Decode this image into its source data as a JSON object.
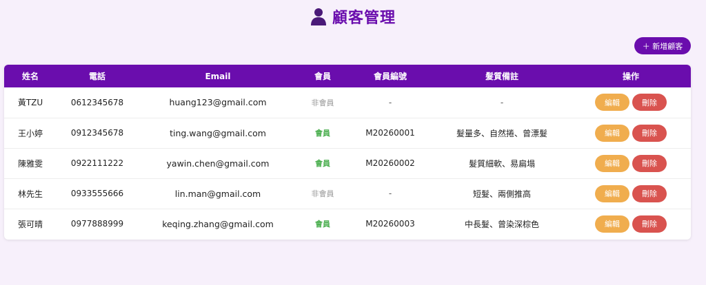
{
  "header": {
    "title": "顧客管理",
    "icon": "user-icon"
  },
  "toolbar": {
    "add_label": "＋ 新增顧客"
  },
  "table": {
    "columns": [
      "姓名",
      "電話",
      "Email",
      "會員",
      "會員編號",
      "髮質備註",
      "操作"
    ],
    "rows": [
      {
        "name": "黃TZU",
        "phone": "0612345678",
        "email": "huang123@gmail.com",
        "member": "非會員",
        "is_member": false,
        "member_id": "-",
        "note": "-",
        "edit": "編輯",
        "delete": "刪除"
      },
      {
        "name": "王小婷",
        "phone": "0912345678",
        "email": "ting.wang@gmail.com",
        "member": "會員",
        "is_member": true,
        "member_id": "M20260001",
        "note": "髮量多、自然捲、曾漂髮",
        "edit": "編輯",
        "delete": "刪除"
      },
      {
        "name": "陳雅雯",
        "phone": "0922111222",
        "email": "yawin.chen@gmail.com",
        "member": "會員",
        "is_member": true,
        "member_id": "M20260002",
        "note": "髮質細軟、易扁塌",
        "edit": "編輯",
        "delete": "刪除"
      },
      {
        "name": "林先生",
        "phone": "0933555666",
        "email": "lin.man@gmail.com",
        "member": "非會員",
        "is_member": false,
        "member_id": "-",
        "note": "短髮、兩側推高",
        "edit": "編輯",
        "delete": "刪除"
      },
      {
        "name": "張可晴",
        "phone": "0977888999",
        "email": "keqing.zhang@gmail.com",
        "member": "會員",
        "is_member": true,
        "member_id": "M20260003",
        "note": "中長髮、曾染深棕色",
        "edit": "編輯",
        "delete": "刪除"
      }
    ]
  },
  "colors": {
    "accent": "#6a0dad",
    "background": "#f7f0fb",
    "member": "#4caf50",
    "non_member": "#999999",
    "edit": "#f0ad4e",
    "delete": "#d9534f"
  }
}
